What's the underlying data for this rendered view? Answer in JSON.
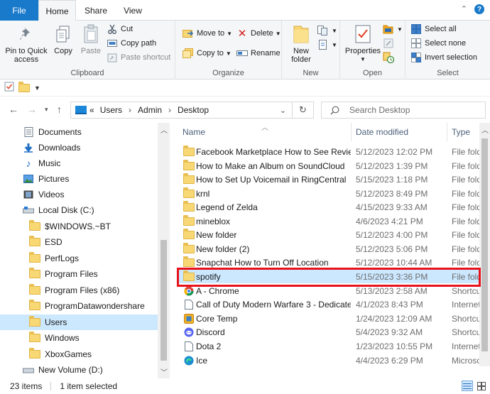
{
  "tabs": {
    "file": "File",
    "home": "Home",
    "share": "Share",
    "view": "View"
  },
  "ribbon": {
    "clipboard": {
      "label": "Clipboard",
      "pin": "Pin to Quick access",
      "copy": "Copy",
      "paste": "Paste",
      "cut": "Cut",
      "copy_path": "Copy path",
      "paste_shortcut": "Paste shortcut"
    },
    "organize": {
      "label": "Organize",
      "move_to": "Move to",
      "delete": "Delete",
      "copy_to": "Copy to",
      "rename": "Rename"
    },
    "new": {
      "label": "New",
      "new_folder": "New folder"
    },
    "open": {
      "label": "Open",
      "properties": "Properties"
    },
    "select": {
      "label": "Select",
      "select_all": "Select all",
      "select_none": "Select none",
      "invert": "Invert selection"
    }
  },
  "address": {
    "path": [
      "Users",
      "Admin",
      "Desktop"
    ],
    "sep": "›",
    "overflow": "«",
    "search_placeholder": "Search Desktop"
  },
  "nav_items": [
    {
      "label": "Documents",
      "icon": "documents-icon"
    },
    {
      "label": "Downloads",
      "icon": "downloads-icon"
    },
    {
      "label": "Music",
      "icon": "music-icon"
    },
    {
      "label": "Pictures",
      "icon": "pictures-icon"
    },
    {
      "label": "Videos",
      "icon": "videos-icon"
    },
    {
      "label": "Local Disk (C:)",
      "icon": "drive-icon"
    },
    {
      "label": "$WINDOWS.~BT",
      "icon": "folder-icon"
    },
    {
      "label": "ESD",
      "icon": "folder-icon"
    },
    {
      "label": "PerfLogs",
      "icon": "folder-icon"
    },
    {
      "label": "Program Files",
      "icon": "folder-icon"
    },
    {
      "label": "Program Files (x86)",
      "icon": "folder-icon"
    },
    {
      "label": "ProgramDatawondershare",
      "icon": "folder-icon"
    },
    {
      "label": "Users",
      "icon": "folder-icon",
      "selected": true
    },
    {
      "label": "Windows",
      "icon": "folder-icon"
    },
    {
      "label": "XboxGames",
      "icon": "folder-icon"
    },
    {
      "label": "New Volume (D:)",
      "icon": "drive-icon"
    }
  ],
  "columns": {
    "name": "Name",
    "date": "Date modified",
    "type": "Type"
  },
  "files": [
    {
      "name": "Facebook Marketplace How to See Revie...",
      "date": "5/12/2023 12:02 PM",
      "type": "File fold",
      "icon": "folder-icon"
    },
    {
      "name": "How to Make an Album on SoundCloud",
      "date": "5/12/2023 1:39 PM",
      "type": "File fold",
      "icon": "folder-icon"
    },
    {
      "name": "How to Set Up Voicemail in RingCentral",
      "date": "5/15/2023 1:18 PM",
      "type": "File fold",
      "icon": "folder-icon"
    },
    {
      "name": "krnl",
      "date": "5/12/2023 8:49 PM",
      "type": "File fold",
      "icon": "folder-icon"
    },
    {
      "name": "Legend of Zelda",
      "date": "4/15/2023 9:33 AM",
      "type": "File fold",
      "icon": "folder-icon"
    },
    {
      "name": "mineblox",
      "date": "4/6/2023 4:21 PM",
      "type": "File fold",
      "icon": "folder-icon"
    },
    {
      "name": "New folder",
      "date": "5/12/2023 4:00 PM",
      "type": "File fold",
      "icon": "folder-icon"
    },
    {
      "name": "New folder (2)",
      "date": "5/12/2023 5:06 PM",
      "type": "File fold",
      "icon": "folder-icon"
    },
    {
      "name": "Snapchat How to Turn Off Location",
      "date": "5/12/2023 10:44 AM",
      "type": "File fold",
      "icon": "folder-icon"
    },
    {
      "name": "spotify",
      "date": "5/15/2023 3:36 PM",
      "type": "File fold",
      "icon": "folder-icon",
      "selected": true
    },
    {
      "name": "A - Chrome",
      "date": "5/13/2023 2:58 AM",
      "type": "Shortcut",
      "icon": "chrome-shortcut-icon"
    },
    {
      "name": "Call of Duty Modern Warfare 3 - Dedicate...",
      "date": "4/1/2023 8:43 PM",
      "type": "Internet",
      "icon": "internet-shortcut-icon"
    },
    {
      "name": "Core Temp",
      "date": "1/24/2023 12:09 AM",
      "type": "Shortcut",
      "icon": "coretemp-icon"
    },
    {
      "name": "Discord",
      "date": "5/4/2023 9:32 AM",
      "type": "Shortcut",
      "icon": "discord-icon"
    },
    {
      "name": "Dota 2",
      "date": "1/23/2023 10:55 PM",
      "type": "Internet",
      "icon": "internet-shortcut-icon"
    },
    {
      "name": "Ice",
      "date": "4/4/2023 6:29 PM",
      "type": "Microso",
      "icon": "edge-icon"
    }
  ],
  "status": {
    "items": "23 items",
    "selected": "1 item selected"
  },
  "colors": {
    "accent": "#1979ca",
    "selection": "#cce8ff",
    "highlight_box": "#e8121c",
    "folder": "#f8d775"
  }
}
